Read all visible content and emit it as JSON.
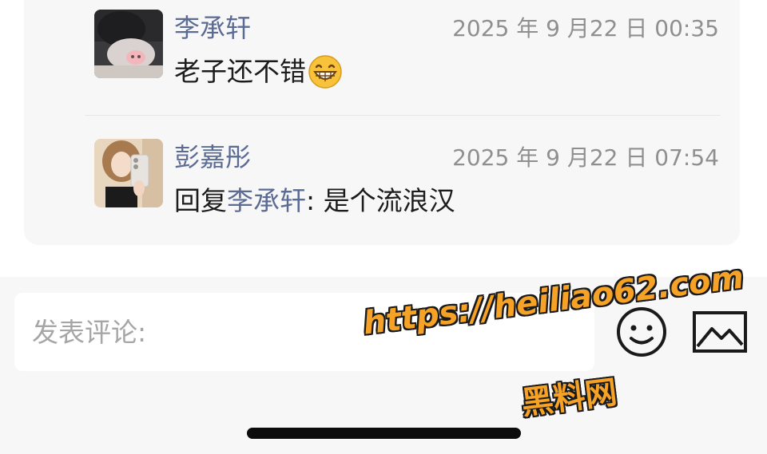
{
  "comments": [
    {
      "author": "李承轩",
      "time": "2025 年 9 月22 日 00:35",
      "text": "老子还不错",
      "emoji": "grinning-emoji"
    },
    {
      "author": "彭嘉彤",
      "time": "2025 年 9 月22 日 07:54",
      "reply_prefix": "回复",
      "reply_to": "李承轩",
      "reply_separator": ": ",
      "text": "是个流浪汉"
    }
  ],
  "comment_input": {
    "placeholder": "发表评论:",
    "value": ""
  },
  "toolbar": {
    "emoji_icon": "emoji-face-icon",
    "image_icon": "image-picture-icon"
  },
  "watermark": {
    "url": "https://heiliao62.com",
    "site": "黑料网"
  },
  "colors": {
    "name_link": "#5b6b93",
    "time": "#8f8f8f",
    "text": "#1c1c1c",
    "placeholder": "#a6a6a6",
    "watermark": "#f5a226"
  }
}
